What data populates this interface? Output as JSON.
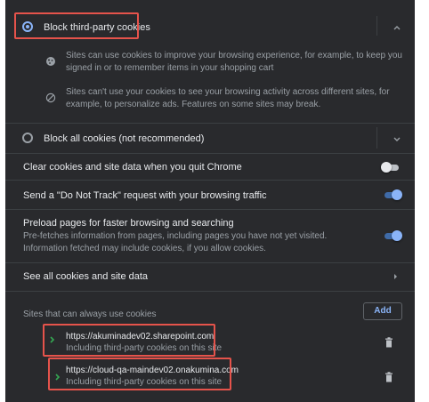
{
  "block_third_party": {
    "label": "Block third-party cookies",
    "selected": true,
    "details": [
      {
        "icon": "cookie-icon",
        "text": "Sites can use cookies to improve your browsing experience, for example, to keep you signed in or to remember items in your shopping cart"
      },
      {
        "icon": "block-icon",
        "text": "Sites can't use your cookies to see your browsing activity across different sites, for example, to personalize ads. Features on some sites may break."
      }
    ]
  },
  "block_all": {
    "label": "Block all cookies (not recommended)",
    "selected": false
  },
  "toggles": [
    {
      "label": "Clear cookies and site data when you quit Chrome",
      "on": false
    },
    {
      "label": "Send a \"Do Not Track\" request with your browsing traffic",
      "on": true
    },
    {
      "label": "Preload pages for faster browsing and searching",
      "sublabel": "Pre-fetches information from pages, including pages you have not yet visited. Information fetched may include cookies, if you allow cookies.",
      "on": true
    }
  ],
  "see_all": {
    "label": "See all cookies and site data"
  },
  "allowed_sites": {
    "heading": "Sites that can always use cookies",
    "add_label": "Add",
    "sites": [
      {
        "url": "https://akuminadev02.sharepoint.com",
        "note": "Including third-party cookies on this site"
      },
      {
        "url": "https://cloud-qa-maindev02.onakumina.com",
        "note": "Including third-party cookies on this site"
      }
    ]
  },
  "colors": {
    "accent": "#8ab4f8",
    "highlight": "#e5534b",
    "background": "#292a2d"
  }
}
